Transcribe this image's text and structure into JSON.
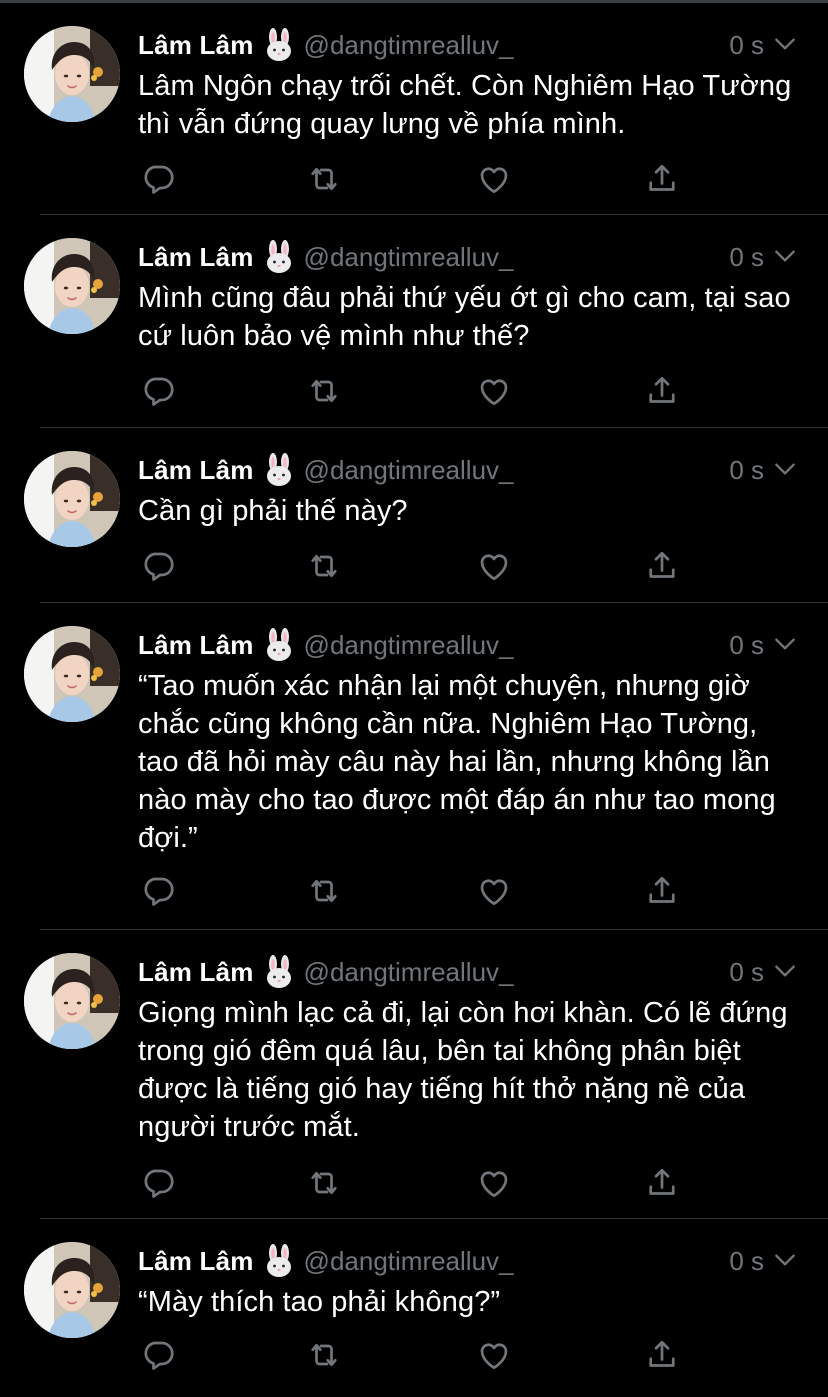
{
  "tweets": [
    {
      "name": "Lâm Lâm",
      "emoji": "rabbit-face-emoji",
      "handle": "@dangtimrealluv_",
      "time": "0 s",
      "text": "Lâm Ngôn chạy trối chết. Còn Nghiêm Hạo Tường thì vẫn đứng quay lưng về phía mình."
    },
    {
      "name": "Lâm Lâm",
      "emoji": "rabbit-face-emoji",
      "handle": "@dangtimrealluv_",
      "time": "0 s",
      "text": "Mình cũng đâu phải thứ yếu ớt gì cho cam, tại sao cứ luôn bảo vệ mình như thế?"
    },
    {
      "name": "Lâm Lâm",
      "emoji": "rabbit-face-emoji",
      "handle": "@dangtimrealluv_",
      "time": "0 s",
      "text": "Cần gì phải thế này?"
    },
    {
      "name": "Lâm Lâm",
      "emoji": "rabbit-face-emoji",
      "handle": "@dangtimrealluv_",
      "time": "0 s",
      "text": "“Tao muốn xác nhận lại một chuyện, nhưng giờ chắc cũng không cần nữa. Nghiêm Hạo Tường, tao đã hỏi mày câu này hai lần, nhưng không lần nào mày cho tao được một đáp án như tao mong đợi.”"
    },
    {
      "name": "Lâm Lâm",
      "emoji": "rabbit-face-emoji",
      "handle": "@dangtimrealluv_",
      "time": "0 s",
      "text": "Giọng mình lạc cả đi, lại còn hơi khàn. Có lẽ đứng trong gió đêm quá lâu, bên tai không phân biệt được là tiếng gió hay tiếng hít thở nặng nề của người trước mắt."
    },
    {
      "name": "Lâm Lâm",
      "emoji": "rabbit-face-emoji",
      "handle": "@dangtimrealluv_",
      "time": "0 s",
      "text": "“Mày thích tao phải không?”"
    }
  ],
  "actions": [
    "reply-icon",
    "retweet-icon",
    "like-icon",
    "share-icon"
  ],
  "colors": {
    "background": "#000000",
    "text": "#ffffff",
    "muted": "#71767b",
    "divider": "#2f3336"
  }
}
